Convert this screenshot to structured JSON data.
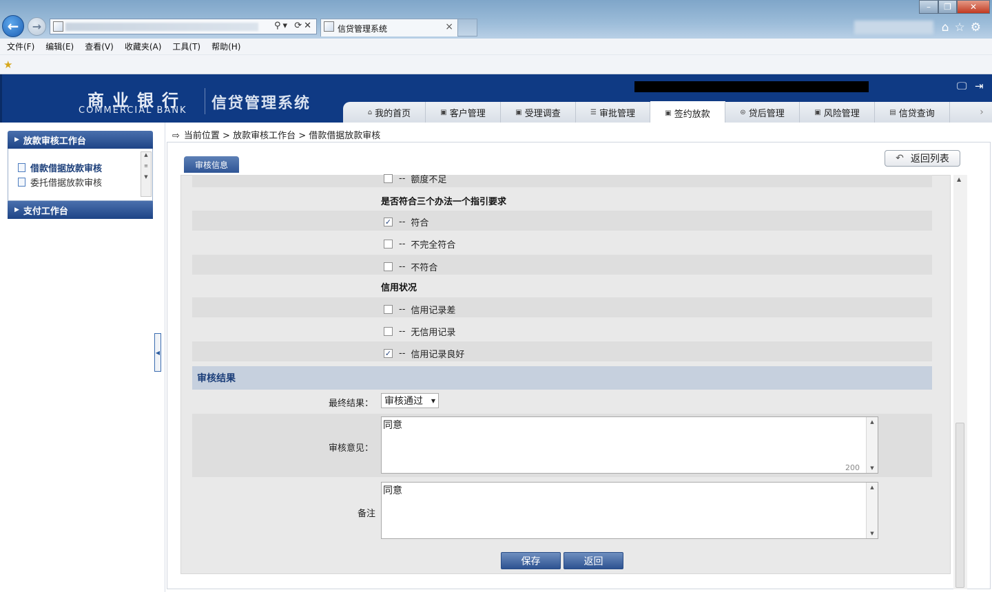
{
  "browser": {
    "tab_title": "信贷管理系统",
    "tab_close": "×",
    "menu": [
      "文件(F)",
      "编辑(E)",
      "查看(V)",
      "收藏夹(A)",
      "工具(T)",
      "帮助(H)"
    ],
    "win_min": "–",
    "win_max": "❐",
    "win_close": "✕",
    "toolbar_icons": "⌂☆⚙",
    "addr_icons": "⚲▾ ⟳✕"
  },
  "header": {
    "logo_cn": "商业银行",
    "logo_en": "COMMERCIAL BANK",
    "system_name": "信贷管理系统",
    "nav": [
      {
        "label": "我的首页",
        "icon": "⌂"
      },
      {
        "label": "客户管理",
        "icon": "▣"
      },
      {
        "label": "受理调查",
        "icon": "▣"
      },
      {
        "label": "审批管理",
        "icon": "☰"
      },
      {
        "label": "签约放款",
        "icon": "▣"
      },
      {
        "label": "贷后管理",
        "icon": "⊜"
      },
      {
        "label": "风险管理",
        "icon": "▣"
      },
      {
        "label": "信贷查询",
        "icon": "▤"
      }
    ],
    "active_nav": "签约放款",
    "nav_more": "›"
  },
  "sidebar": {
    "group1": "放款审核工作台",
    "items": [
      "借款借据放款审核",
      "委托借据放款审核"
    ],
    "group2": "支付工作台"
  },
  "breadcrumb": "当前位置 > 放款审核工作台 > 借款借据放款审核",
  "tab_audit": "审核信息",
  "btn_return_list": "返回列表",
  "options": {
    "partial_top": "额度不足",
    "section1": "是否符合三个办法一个指引要求",
    "section1_opts": [
      {
        "label": "符合",
        "checked": true
      },
      {
        "label": "不完全符合",
        "checked": false
      },
      {
        "label": "不符合",
        "checked": false
      }
    ],
    "section2": "信用状况",
    "section2_opts": [
      {
        "label": "信用记录差",
        "checked": false
      },
      {
        "label": "无信用记录",
        "checked": false
      },
      {
        "label": "信用记录良好",
        "checked": true
      }
    ],
    "dash": "--",
    "check_mark": "✓"
  },
  "result": {
    "heading": "审核结果",
    "final_label": "最终结果：",
    "final_value": "审核通过",
    "opinion_label": "审核意见：",
    "opinion_value": "同意",
    "opinion_count": "200",
    "remark_label": "备注",
    "remark_value": "同意"
  },
  "buttons": {
    "save": "保存",
    "back": "返回"
  }
}
